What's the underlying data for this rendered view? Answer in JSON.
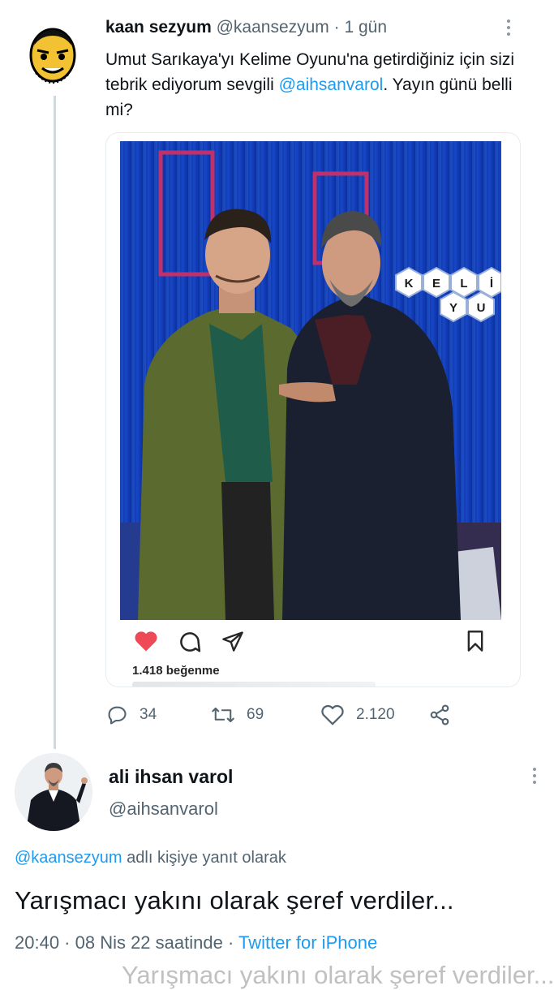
{
  "tweet1": {
    "author_name": "kaan sezyum",
    "handle": "@kaansezyum",
    "separator": " · ",
    "time": "1 gün",
    "text_before": "Umut Sarıkaya'yı Kelime Oyunu'na getirdiğiniz için sizi  tebrik ediyorum sevgili ",
    "mention": "@aihsanvarol",
    "text_after": ". Yayın günü belli mi?",
    "attached_post": {
      "likes": "1.418 beğenme",
      "photo_studio_letters": [
        "K",
        "E",
        "L",
        "İ",
        "Y",
        "U"
      ]
    },
    "counts": {
      "replies": "34",
      "retweets": "69",
      "likes": "2.120"
    }
  },
  "tweet2": {
    "author_name": "ali ihsan varol",
    "handle": "@aihsanvarol",
    "reply_mention": "@kaansezyum",
    "reply_suffix": " adlı kişiye yanıt olarak",
    "text": "Yarışmacı yakını olarak şeref verdiler...",
    "time": "20:40 · 08 Nis 22 saatinde · ",
    "source": "Twitter for iPhone",
    "ghost_text": "Yarışmacı yakını olarak şeref verdiler..."
  },
  "colors": {
    "accent": "#1d9bf0",
    "heart": "#ed4956",
    "text_secondary": "#536471"
  },
  "icons": [
    "more-vertical-icon",
    "heart-icon",
    "comment-icon",
    "send-icon",
    "bookmark-icon",
    "reply-icon",
    "retweet-icon",
    "like-icon",
    "share-icon"
  ]
}
